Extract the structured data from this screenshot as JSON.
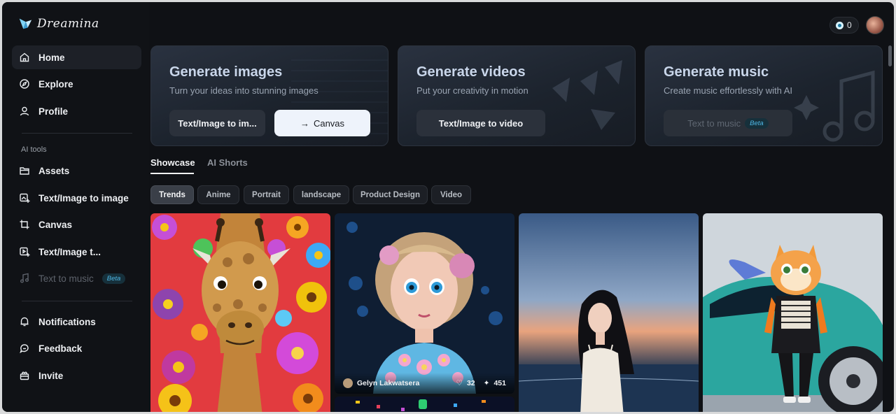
{
  "brand": {
    "name": "Dreamina"
  },
  "header": {
    "credits": "0"
  },
  "sidebar": {
    "items": [
      {
        "label": "Home",
        "icon": "home-icon"
      },
      {
        "label": "Explore",
        "icon": "explore-icon"
      },
      {
        "label": "Profile",
        "icon": "profile-icon"
      }
    ],
    "section_label": "AI tools",
    "tools": [
      {
        "label": "Assets",
        "icon": "folder-icon"
      },
      {
        "label": "Text/Image to image",
        "icon": "image-plus-icon"
      },
      {
        "label": "Canvas",
        "icon": "crop-icon"
      },
      {
        "label": "Text/Image t...",
        "icon": "video-plus-icon"
      },
      {
        "label": "Text to music",
        "icon": "music-note-icon",
        "badge": "Beta"
      }
    ],
    "bottom": [
      {
        "label": "Notifications",
        "icon": "bell-icon"
      },
      {
        "label": "Feedback",
        "icon": "feedback-icon"
      },
      {
        "label": "Invite",
        "icon": "gift-icon"
      }
    ]
  },
  "cards": [
    {
      "title": "Generate images",
      "subtitle": "Turn your ideas into stunning images",
      "buttons": [
        "Text/Image to im...",
        "Canvas"
      ]
    },
    {
      "title": "Generate videos",
      "subtitle": "Put your creativity in motion",
      "buttons": [
        "Text/Image to video"
      ]
    },
    {
      "title": "Generate music",
      "subtitle": "Create music effortlessly with AI",
      "buttons": [
        "Text to music"
      ],
      "badge": "Beta"
    }
  ],
  "tabs": [
    "Showcase",
    "AI Shorts"
  ],
  "filters": [
    "Trends",
    "Anime",
    "Portrait",
    "landscape",
    "Product Design",
    "Video"
  ],
  "gallery": {
    "featured": {
      "author": "Gelyn Lakwatsera",
      "likes": "32",
      "uses": "451"
    }
  },
  "colors": {
    "background": "#0f1115",
    "accent": "#4fb8e6"
  }
}
